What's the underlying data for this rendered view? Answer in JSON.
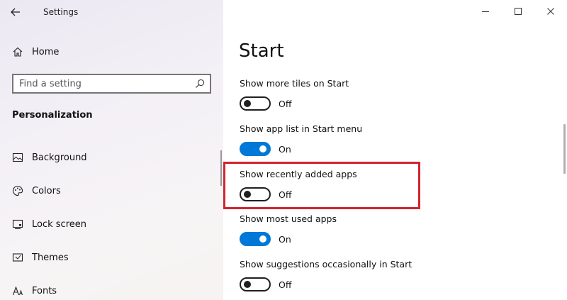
{
  "window": {
    "title": "Settings",
    "controls": [
      "minimize",
      "maximize",
      "close"
    ]
  },
  "sidebar": {
    "home_label": "Home",
    "search_placeholder": "Find a setting",
    "section_title": "Personalization",
    "items": [
      {
        "label": "Background",
        "icon": "picture-icon"
      },
      {
        "label": "Colors",
        "icon": "palette-icon"
      },
      {
        "label": "Lock screen",
        "icon": "lock-screen-icon"
      },
      {
        "label": "Themes",
        "icon": "themes-icon"
      },
      {
        "label": "Fonts",
        "icon": "fonts-icon"
      }
    ]
  },
  "main": {
    "page_title": "Start",
    "settings": [
      {
        "label": "Show more tiles on Start",
        "state": "Off",
        "on": false
      },
      {
        "label": "Show app list in Start menu",
        "state": "On",
        "on": true
      },
      {
        "label": "Show recently added apps",
        "state": "Off",
        "on": false,
        "highlighted": true
      },
      {
        "label": "Show most used apps",
        "state": "On",
        "on": true
      },
      {
        "label": "Show suggestions occasionally in Start",
        "state": "Off",
        "on": false
      }
    ]
  },
  "colors": {
    "accent": "#0078d7",
    "highlight_border": "#d1242f"
  }
}
